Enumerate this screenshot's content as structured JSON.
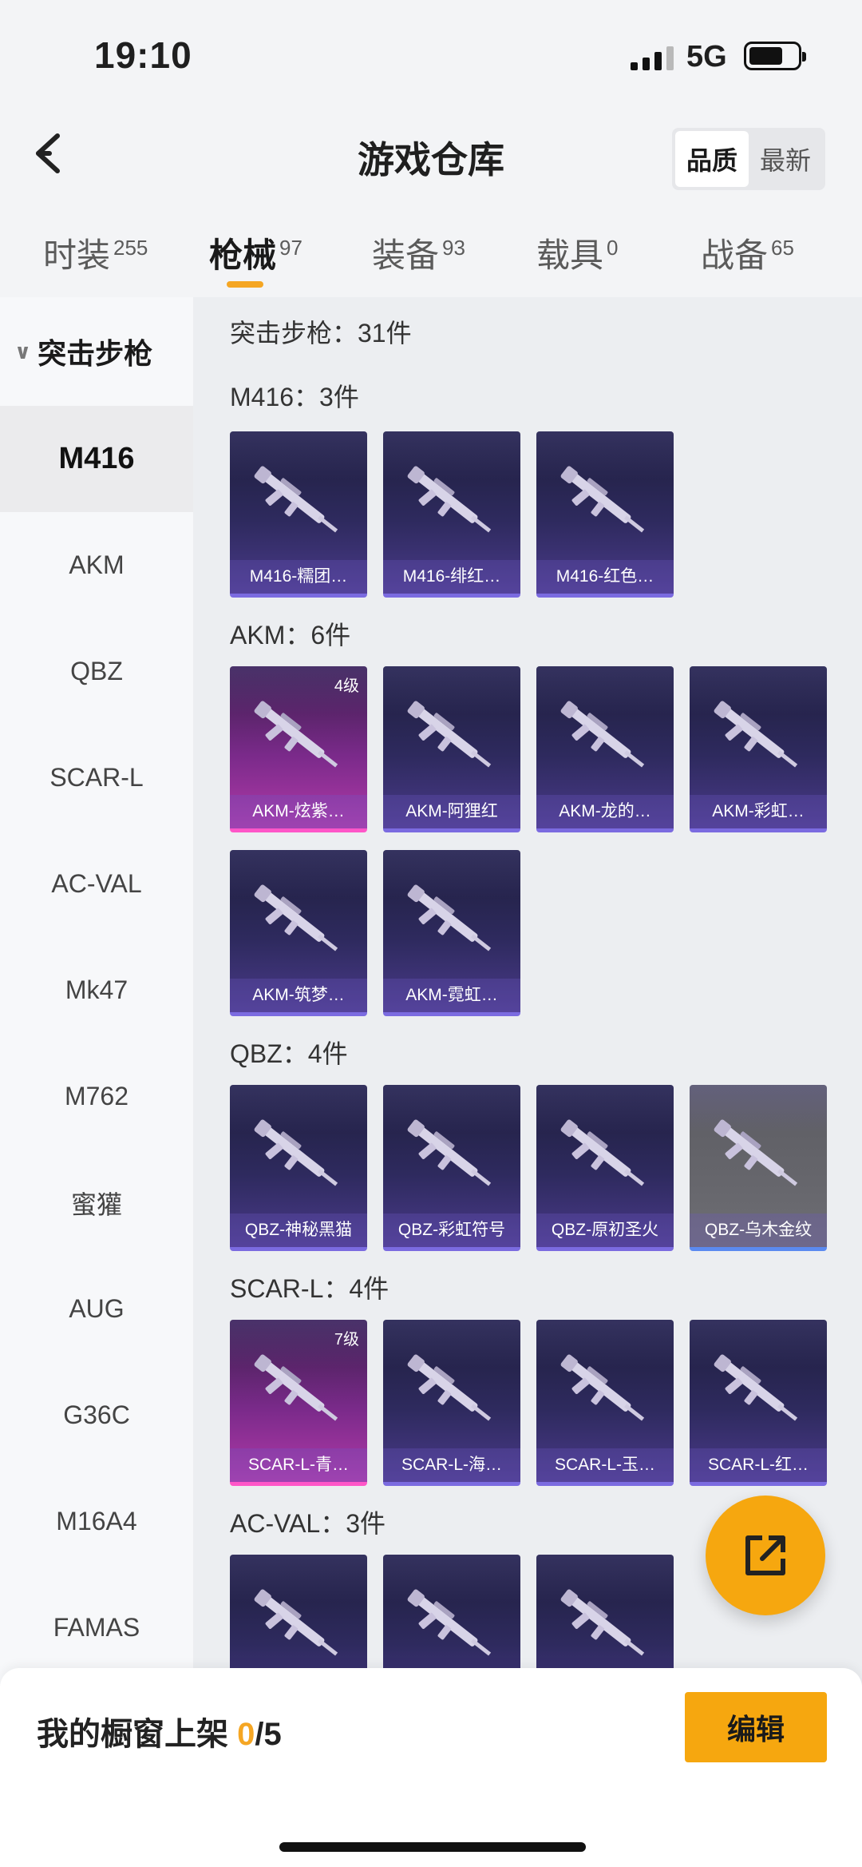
{
  "status_bar": {
    "time": "19:10",
    "network": "5G"
  },
  "nav": {
    "title": "游戏仓库",
    "sort_options": [
      "品质",
      "最新"
    ],
    "selected_sort": "品质"
  },
  "tabs": [
    {
      "label": "时装",
      "count": "255"
    },
    {
      "label": "枪械",
      "count": "97"
    },
    {
      "label": "装备",
      "count": "93"
    },
    {
      "label": "载具",
      "count": "0"
    },
    {
      "label": "战备",
      "count": "65"
    }
  ],
  "active_tab": "枪械",
  "sidebar": {
    "group": "突击步枪",
    "items": [
      "M416",
      "AKM",
      "QBZ",
      "SCAR-L",
      "AC-VAL",
      "Mk47",
      "M762",
      "蜜獾",
      "AUG",
      "G36C",
      "M16A4",
      "FAMAS"
    ],
    "selected": "M416"
  },
  "content": {
    "summary": "突击步枪：31件",
    "groups": [
      {
        "title": "M416：3件",
        "items": [
          {
            "name": "M416-糯团…"
          },
          {
            "name": "M416-绯红…"
          },
          {
            "name": "M416-红色…"
          }
        ]
      },
      {
        "title": "AKM：6件",
        "items": [
          {
            "name": "AKM-炫紫…",
            "level": "4级"
          },
          {
            "name": "AKM-阿狸红"
          },
          {
            "name": "AKM-龙的…"
          },
          {
            "name": "AKM-彩虹…"
          },
          {
            "name": "AKM-筑梦…"
          },
          {
            "name": "AKM-霓虹…"
          }
        ]
      },
      {
        "title": "QBZ：4件",
        "items": [
          {
            "name": "QBZ-神秘黑猫"
          },
          {
            "name": "QBZ-彩虹符号"
          },
          {
            "name": "QBZ-原初圣火"
          },
          {
            "name": "QBZ-乌木金纹"
          }
        ]
      },
      {
        "title": "SCAR-L：4件",
        "items": [
          {
            "name": "SCAR-L-青…",
            "level": "7级"
          },
          {
            "name": "SCAR-L-海…"
          },
          {
            "name": "SCAR-L-玉…"
          },
          {
            "name": "SCAR-L-红…"
          }
        ]
      },
      {
        "title": "AC-VAL：3件",
        "items": []
      }
    ]
  },
  "bottom": {
    "label": "我的橱窗上架 ",
    "current": "0",
    "total": "/5",
    "edit": "编辑"
  },
  "icons": {
    "back": "chevron-left-icon",
    "share": "external-link-icon",
    "gun": "rifle-icon"
  },
  "colors": {
    "accent": "#f6a70f",
    "card_purple": "#2e2a5e",
    "card_pink": "#b13aa8",
    "card_gray": "#66666c"
  }
}
